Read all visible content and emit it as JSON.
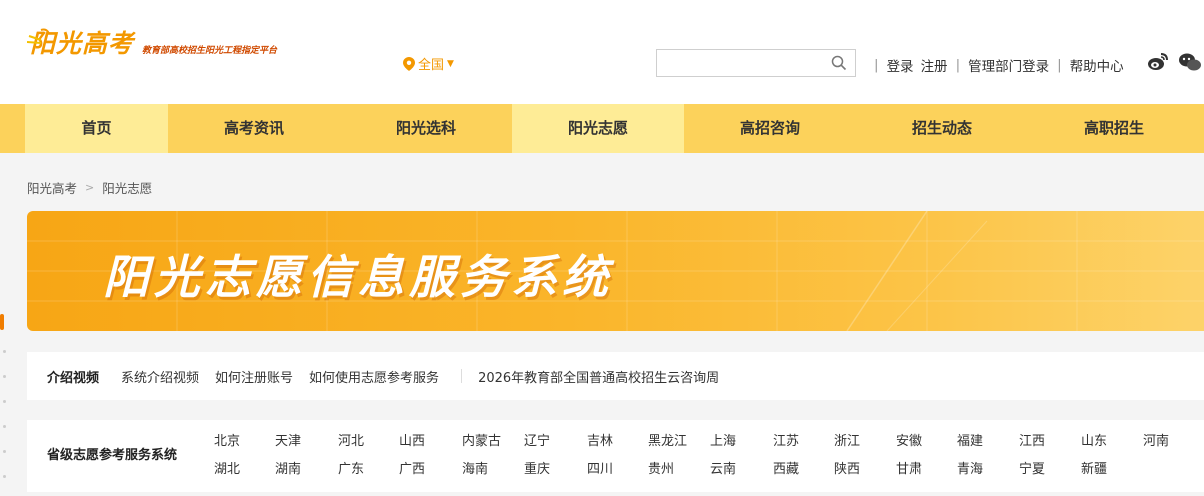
{
  "header": {
    "logo_text": "阳光高考",
    "logo_tagline": "教育部高校招生阳光工程指定平台",
    "region_label": "全国",
    "search_placeholder": "",
    "links": {
      "login": "登录",
      "register": "注册",
      "admin_login": "管理部门登录",
      "help": "帮助中心"
    },
    "sep": "|",
    "social": [
      "weibo-icon",
      "wechat-icon"
    ]
  },
  "nav": {
    "items": [
      "首页",
      "高考资讯",
      "阳光选科",
      "阳光志愿",
      "高招咨询",
      "招生动态",
      "高职招生"
    ],
    "active_index": 3
  },
  "breadcrumb": {
    "items": [
      "阳光高考",
      "阳光志愿"
    ],
    "separator": ">"
  },
  "banner": {
    "title": "阳光志愿信息服务系统"
  },
  "intro": {
    "label": "介绍视频",
    "links": [
      "系统介绍视频",
      "如何注册账号",
      "如何使用志愿参考服务"
    ],
    "extra": "2026年教育部全国普通高校招生云咨询周"
  },
  "provinces": {
    "label": "省级志愿参考服务系统",
    "row1": [
      "北京",
      "天津",
      "河北",
      "山西",
      "内蒙古",
      "辽宁",
      "吉林",
      "黑龙江",
      "上海",
      "江苏",
      "浙江",
      "安徽",
      "福建",
      "江西",
      "山东",
      "河南"
    ],
    "row2": [
      "湖北",
      "湖南",
      "广东",
      "广西",
      "海南",
      "重庆",
      "四川",
      "贵州",
      "云南",
      "西藏",
      "陕西",
      "甘肃",
      "青海",
      "宁夏",
      "新疆"
    ]
  },
  "colors": {
    "accent": "#f39800",
    "nav_bg": "#fcd25b",
    "nav_active": "#feec96",
    "banner_start": "#f7a615",
    "banner_end": "#fdd46c"
  }
}
